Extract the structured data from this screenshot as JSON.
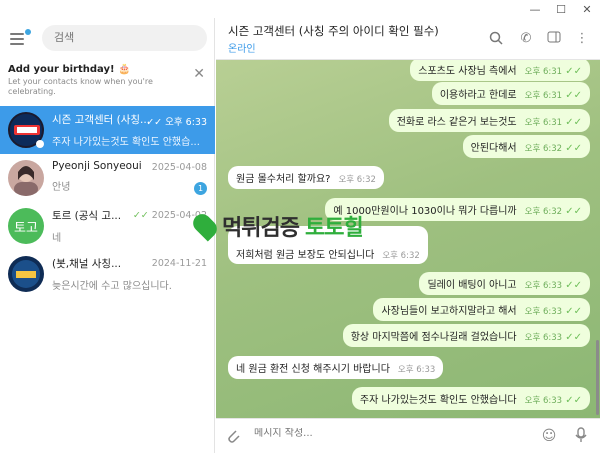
{
  "window": {
    "minimize": "—",
    "maximize": "☐",
    "close": "✕"
  },
  "sidebar": {
    "search_placeholder": "검색",
    "birthday": {
      "title": "Add your birthday! 🎂",
      "subtitle": "Let your contacts know when you're celebrating."
    },
    "chats": [
      {
        "name": "시즌 고객센터 (사칭...",
        "time": "오후 6:33",
        "message": "주자 나가있는것도 확인도 안했습...",
        "active": true
      },
      {
        "name": "Pyeonji Sonyeoui",
        "time": "2025-04-08",
        "message": "안녕",
        "unread": "1"
      },
      {
        "name": "토르 (공식 고...",
        "time": "2025-04-02",
        "message": "네",
        "avatar_text": "토고"
      },
      {
        "name": "(봇,채널 사칭...",
        "time": "2024-11-21",
        "message": "늦은시간에 수고 많으십니다."
      }
    ]
  },
  "header": {
    "title": "시즌 고객센터 (사칭 주의 아이디 확인 필수)",
    "status": "온라인"
  },
  "messages": [
    {
      "dir": "out",
      "text": "스포츠도 사장님 측에서",
      "time": "오후 6:31"
    },
    {
      "dir": "out",
      "text": "이용하라고 한데로",
      "time": "오후 6:31"
    },
    {
      "dir": "out",
      "text": "전화로 라스 같은거 보는것도",
      "time": "오후 6:31"
    },
    {
      "dir": "out",
      "text": "안된다해서",
      "time": "오후 6:32"
    },
    {
      "dir": "in",
      "text": "원금 몰수처리 할까요?",
      "time": "오후 6:32"
    },
    {
      "dir": "out",
      "text": "예 1000만원이나 1030이나 뭐가 다릅니까",
      "time": "오후 6:32"
    },
    {
      "dir": "in",
      "text": "저희처럼 원금 보장도 안되십니다",
      "time": "오후 6:32"
    },
    {
      "dir": "out",
      "text": "딜레이 배팅이 아니고",
      "time": "오후 6:33"
    },
    {
      "dir": "out",
      "text": "사장님들이 보고하지말라고 해서",
      "time": "오후 6:33"
    },
    {
      "dir": "out",
      "text": "항상 마지막쯤에 점수나길래 걸었습니다",
      "time": "오후 6:33"
    },
    {
      "dir": "in",
      "text": "네 원금 환전 신청 해주시기 바랍니다",
      "time": "오후 6:33"
    },
    {
      "dir": "out",
      "text": "주자 나가있는것도 확인도 안했습니다",
      "time": "오후 6:33"
    }
  ],
  "watermark": {
    "part1": "먹튀검증",
    "part2": "토토힐"
  },
  "composer": {
    "placeholder": "메시지 작성..."
  }
}
